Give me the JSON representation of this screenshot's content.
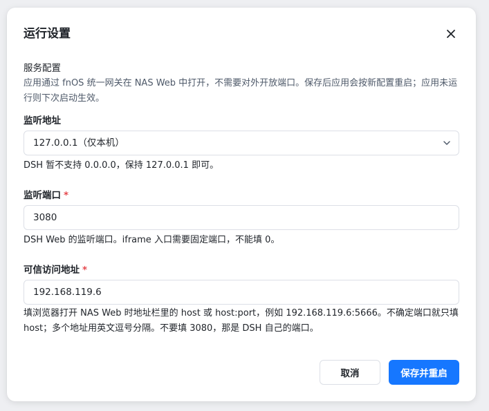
{
  "dialog": {
    "title": "运行设置",
    "close_icon": "close-icon"
  },
  "service": {
    "title": "服务配置",
    "desc": "应用通过 fnOS 统一网关在 NAS Web 中打开，不需要对外开放端口。保存后应用会按新配置重启；应用未运行则下次启动生效。"
  },
  "listen_address": {
    "label": "监听地址",
    "selected": "127.0.0.1（仅本机）",
    "help": "DSH 暂不支持 0.0.0.0，保持 127.0.0.1 即可。"
  },
  "listen_port": {
    "label": "监听端口",
    "required_mark": "*",
    "value": "3080",
    "help": "DSH Web 的监听端口。iframe 入口需要固定端口，不能填 0。"
  },
  "trusted_address": {
    "label": "可信访问地址",
    "required_mark": "*",
    "value": "192.168.119.6",
    "help": "填浏览器打开 NAS Web 时地址栏里的 host 或 host:port，例如 192.168.119.6:5666。不确定端口就只填 host；多个地址用英文逗号分隔。不要填 3080，那是 DSH 自己的端口。"
  },
  "footer": {
    "cancel_label": "取消",
    "save_label": "保存并重启"
  },
  "colors": {
    "primary": "#1677ff",
    "required": "#e5484d"
  }
}
